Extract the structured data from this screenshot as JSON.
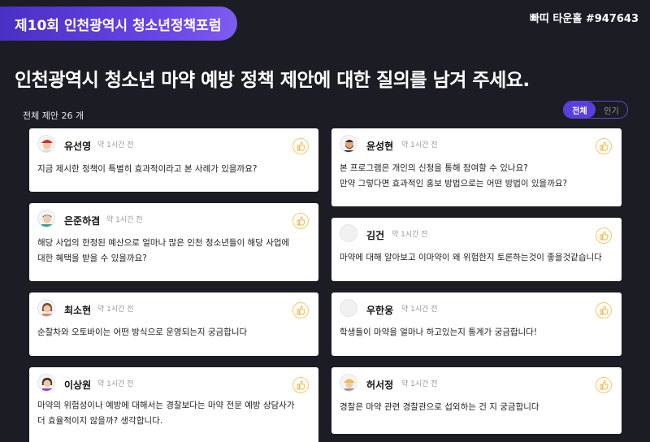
{
  "header": {
    "forum_title": "제10회 인천광역시 청소년정책포럼",
    "room_label": "빠띠 타운홀 #947643"
  },
  "headline": "인천광역시 청소년 마약 예방 정책 제안에 대한 질의를 남겨 주세요.",
  "count_label": "전체 제안 26 개",
  "sort_toggle": {
    "all": "전체",
    "popular": "인기",
    "selected": "전체"
  },
  "questions_left": [
    {
      "name": "유선영",
      "time": "약 1시간 전",
      "avatar": "avatar-woman-red-hat",
      "text_lines": [
        "지금 제시한 정책이 특별히 효과적이라고 본 사례가 있을까요?"
      ]
    },
    {
      "name": "은준하겸",
      "time": "약 1시간 전",
      "avatar": "avatar-man-teal",
      "text_lines": [
        "해당 사업의 한정된 예산으로 얼마나 많은 인천 청소년들이 해당 사업에",
        "대한 혜택을 받을 수 있을까요?"
      ]
    },
    {
      "name": "최소현",
      "time": "약 1시간 전",
      "avatar": "avatar-woman-brown-hair",
      "text_lines": [
        "순찰차와 오토바이는 어떤 방식으로 운영되는지 궁금합니다"
      ]
    },
    {
      "name": "이상원",
      "time": "약 1시간 전",
      "avatar": "avatar-woman-purple",
      "text_lines": [
        "마약의 위험성이나 예방에 대해서는 경찰보다는 마약 전문 예방 상담사가",
        "더 효율적이지 않을까? 생각합니다."
      ]
    }
  ],
  "questions_right": [
    {
      "name": "윤성현",
      "time": "약 1시간 전",
      "avatar": "avatar-man-beard",
      "text_lines": [
        "본 프로그램은 개인의 신청을 통해 참여할 수 있나요?",
        "만약 그렇다면 효과적인 홍보 방법으로는 어떤 방법이 있을까요?"
      ]
    },
    {
      "name": "김건",
      "time": "약 1시간 전",
      "avatar": "avatar-blank",
      "text_lines": [
        "마약에 대해 알아보고 이마약이 왜 위험한지 토론하는것이 좋을것같습니다"
      ]
    },
    {
      "name": "우한웅",
      "time": "약 1시간 전",
      "avatar": "avatar-blank",
      "text_lines": [
        "학생들이 마약을 얼마나 하고있는지 통계가 궁금합니다!"
      ]
    },
    {
      "name": "허서정",
      "time": "약 1시간 전",
      "avatar": "avatar-woman-yellow-hat",
      "text_lines": [
        "경찰은 마약 관련 경찰관으로 섭외하는 건 지 궁금합니다"
      ]
    }
  ],
  "colors": {
    "accent": "#5a3fe0",
    "background": "#1c1c24",
    "like_ring": "#f4c96b"
  }
}
